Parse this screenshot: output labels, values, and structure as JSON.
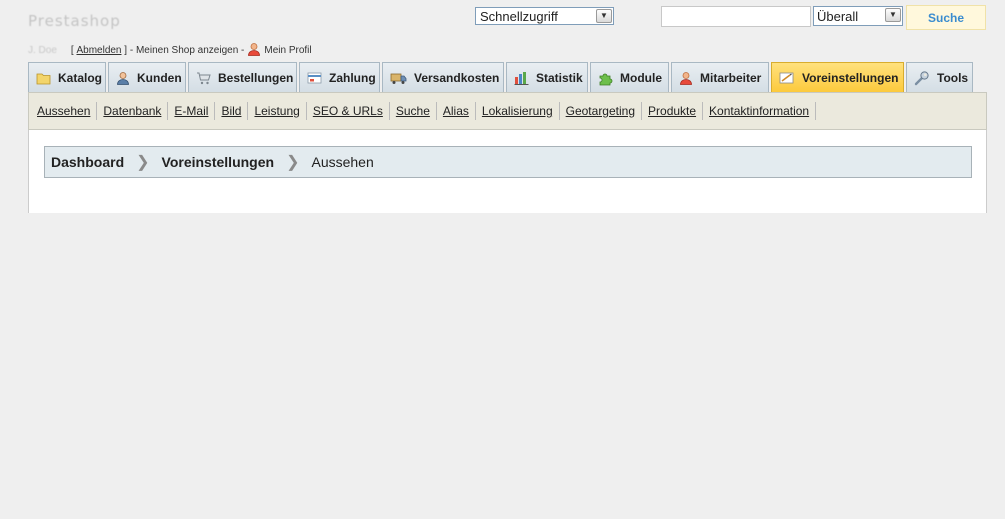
{
  "header": {
    "logo_text": "Prestashop",
    "quick_access": {
      "selected": "Schnellzugriff"
    },
    "search": {
      "value": "",
      "scope": "Überall",
      "button_label": "Suche"
    }
  },
  "userline": {
    "user_name": "J. Doe",
    "bracket_open": "[",
    "logout_label": "Abmelden",
    "bracket_close": "]",
    "shop_text": "- Meinen Shop anzeigen -",
    "profile_label": "Mein Profil"
  },
  "tabs": [
    {
      "label": "Katalog",
      "icon": "folder-icon"
    },
    {
      "label": "Kunden",
      "icon": "customer-icon"
    },
    {
      "label": "Bestellungen",
      "icon": "cart-icon"
    },
    {
      "label": "Zahlung",
      "icon": "payment-icon"
    },
    {
      "label": "Versandkosten",
      "icon": "truck-icon"
    },
    {
      "label": "Statistik",
      "icon": "chart-icon"
    },
    {
      "label": "Module",
      "icon": "puzzle-icon"
    },
    {
      "label": "Mitarbeiter",
      "icon": "employee-icon"
    },
    {
      "label": "Voreinstellungen",
      "icon": "preferences-icon",
      "active": true
    },
    {
      "label": "Tools",
      "icon": "wrench-icon"
    }
  ],
  "subnav": [
    "Aussehen",
    "Datenbank",
    "E-Mail",
    "Bild",
    "Leistung",
    "SEO & URLs",
    "Suche",
    "Alias",
    "Lokalisierung",
    "Geotargeting",
    "Produkte",
    "Kontaktinformation"
  ],
  "breadcrumb": [
    "Dashboard",
    "Voreinstellungen",
    "Aussehen"
  ],
  "colors": {
    "active_tab": "#fcc93a",
    "search_button_text": "#3a8ccf"
  }
}
